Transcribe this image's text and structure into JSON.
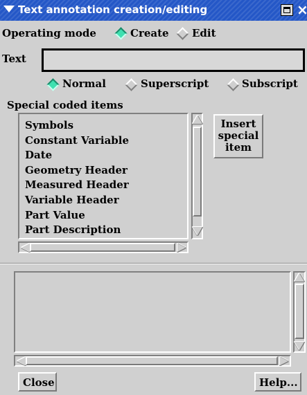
{
  "window": {
    "title": "Text annotation creation/editing",
    "close_glyph": "×"
  },
  "operating_mode": {
    "label": "Operating mode",
    "options": [
      {
        "label": "Create",
        "selected": true
      },
      {
        "label": "Edit",
        "selected": false
      }
    ]
  },
  "text_field": {
    "label": "Text",
    "value": ""
  },
  "text_style": {
    "options": [
      {
        "label": "Normal",
        "selected": true
      },
      {
        "label": "Superscript",
        "selected": false
      },
      {
        "label": "Subscript",
        "selected": false
      }
    ]
  },
  "special_items": {
    "label": "Special coded items",
    "items": [
      "Symbols",
      "Constant Variable",
      "Date",
      "Geometry Header",
      "Measured Header",
      "Variable Header",
      "Part Value",
      "Part Description"
    ],
    "insert_button": [
      "Insert",
      "special",
      "item"
    ]
  },
  "footer": {
    "close_label": "Close",
    "help_label": "Help..."
  },
  "colors": {
    "titlebar": "#2457c7",
    "window_bg": "#d0d0d0",
    "radio_selected": "#3fe0b0"
  }
}
